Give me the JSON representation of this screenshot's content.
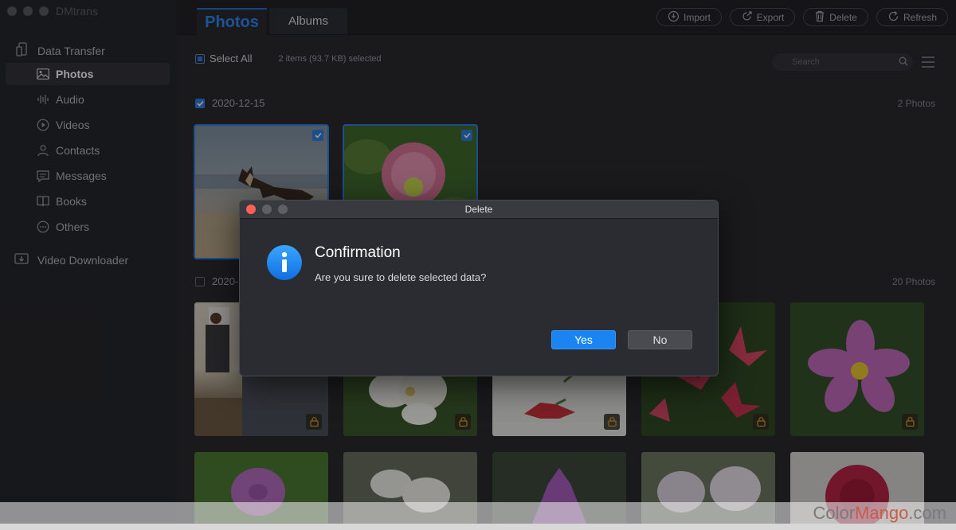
{
  "app": {
    "title": "DMtrans"
  },
  "sidebar": {
    "data_transfer_label": "Data Transfer",
    "items": [
      {
        "label": "Photos",
        "icon": "photo-icon"
      },
      {
        "label": "Audio",
        "icon": "audio-wave-icon"
      },
      {
        "label": "Videos",
        "icon": "play-circle-icon"
      },
      {
        "label": "Contacts",
        "icon": "contact-icon"
      },
      {
        "label": "Messages",
        "icon": "message-icon"
      },
      {
        "label": "Books",
        "icon": "book-icon"
      },
      {
        "label": "Others",
        "icon": "more-circle-icon"
      }
    ],
    "video_downloader_label": "Video Downloader"
  },
  "tabs": {
    "photos": "Photos",
    "albums": "Albums"
  },
  "toolbar": {
    "import": "Import",
    "export": "Export",
    "delete": "Delete",
    "refresh": "Refresh"
  },
  "select_bar": {
    "select_all": "Select All",
    "selection_info": "2 items (93.7 KB) selected"
  },
  "search": {
    "placeholder": "Search"
  },
  "groups": [
    {
      "date": "2020-12-15",
      "count": "2 Photos"
    },
    {
      "date": "2020-",
      "count": "20 Photos"
    }
  ],
  "dialog": {
    "window_title": "Delete",
    "heading": "Confirmation",
    "message": "Are you sure to delete selected data?",
    "yes": "Yes",
    "no": "No"
  },
  "watermark": {
    "part1": "Color",
    "part2": "Mango",
    "part3": ".com"
  },
  "colors": {
    "accent": "#2f7de0",
    "tab_active": "#2f86f5",
    "yes_button": "#1a84f2",
    "close_light": "#fe5f57"
  }
}
